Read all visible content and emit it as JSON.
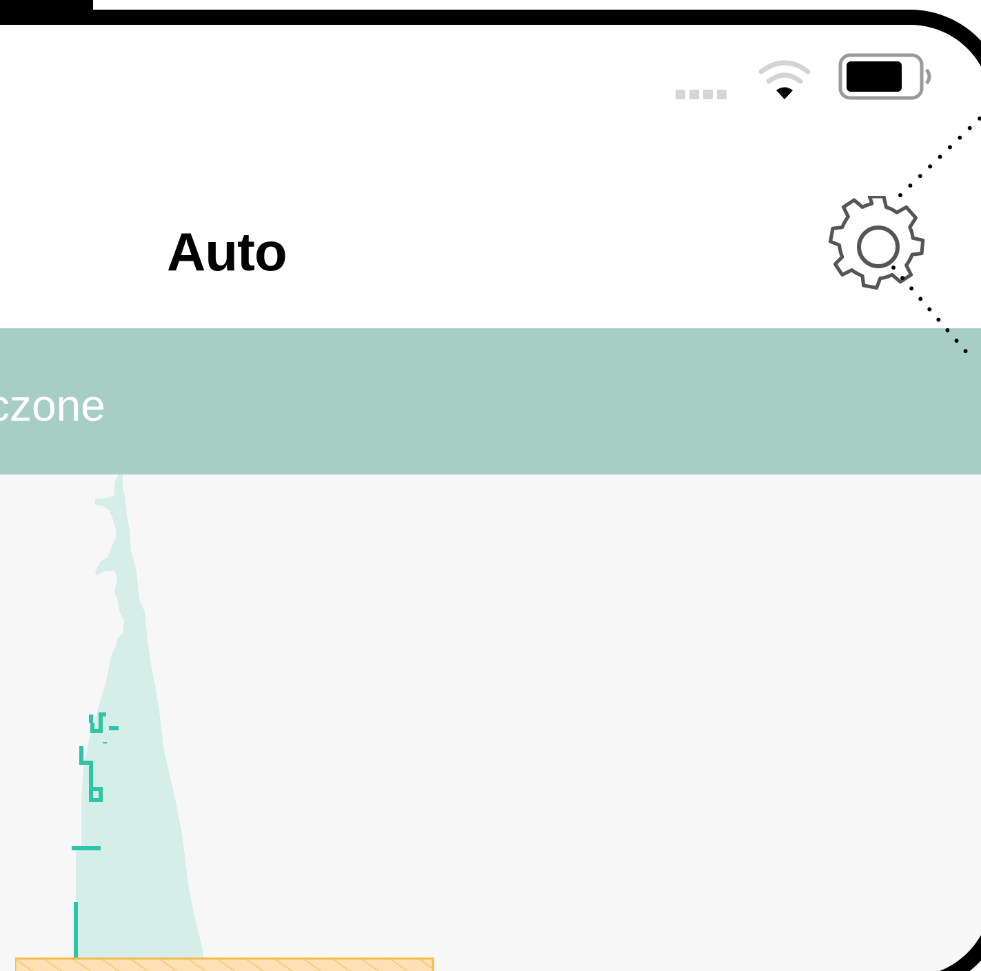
{
  "app": {
    "title": "Auto"
  },
  "status_bar": {
    "signal_icon": "signal-dots-icon",
    "wifi_icon": "wifi-icon",
    "battery_icon": "battery-icon",
    "battery_level": 0.8
  },
  "header": {
    "settings_icon": "gear-icon"
  },
  "banner": {
    "text_visible": "czone",
    "background": "#a7cec5",
    "text_color": "#ffffff"
  },
  "colors": {
    "accent": "#2ec4a6",
    "chart_fill": "#d5efe8",
    "range_band": "#fde1b4",
    "range_band_border": "#f6b94a",
    "content_bg": "#f7f7f7"
  }
}
